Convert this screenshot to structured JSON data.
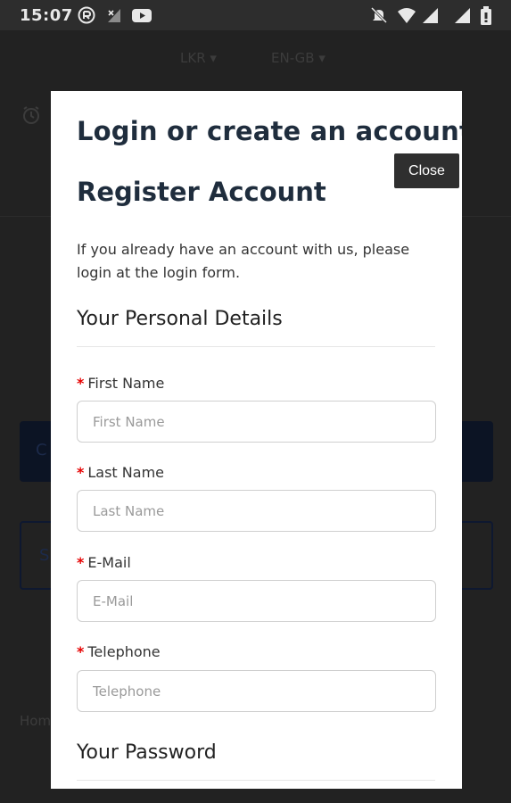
{
  "status_bar": {
    "time": "15:07",
    "icons": [
      "at-sign-icon",
      "no-signal-icon",
      "youtube-icon",
      "mute-icon",
      "wifi-icon",
      "signal-icon",
      "signal-icon",
      "battery-icon"
    ]
  },
  "background": {
    "currency": "LKR",
    "language": "EN-GB",
    "button_fragment": "C",
    "search_fragment": "S",
    "breadcrumb_fragment": "Hom"
  },
  "modal": {
    "title": "Login or create an account",
    "close_label": "Close",
    "register_title": "Register Account",
    "intro": "If you already have an account with us, please login at the login form.",
    "personal_details": {
      "legend": "Your Personal Details",
      "fields": [
        {
          "label": "First Name",
          "placeholder": "First Name",
          "value": "",
          "required": true
        },
        {
          "label": "Last Name",
          "placeholder": "Last Name",
          "value": "",
          "required": true
        },
        {
          "label": "E-Mail",
          "placeholder": "E-Mail",
          "value": "",
          "required": true
        },
        {
          "label": "Telephone",
          "placeholder": "Telephone",
          "value": "",
          "required": true
        }
      ]
    },
    "password_section": {
      "legend": "Your Password"
    }
  },
  "colors": {
    "heading": "#1f2d3d",
    "required_star": "#e60000",
    "close_button_bg": "#2f2f2f",
    "backdrop": "#222222"
  }
}
